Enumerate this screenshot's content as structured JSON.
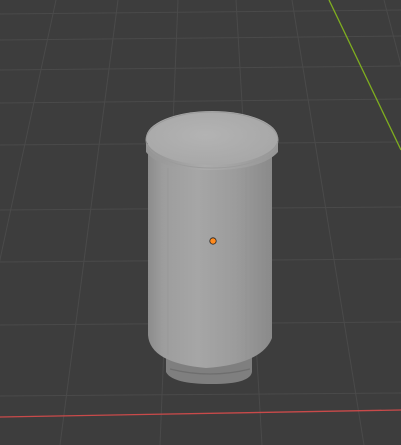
{
  "viewport": {
    "view": "3D Viewport",
    "background_color": "#3d3d3d",
    "grid_color": "#4a4a4a",
    "x_axis_color": "#c94a4a",
    "y_axis_color": "#7fae1f",
    "object": {
      "kind": "cylinder-mesh",
      "body_color": "#9a9a9a",
      "top_color": "#adadad",
      "origin_color": "#ff8a1e"
    }
  }
}
